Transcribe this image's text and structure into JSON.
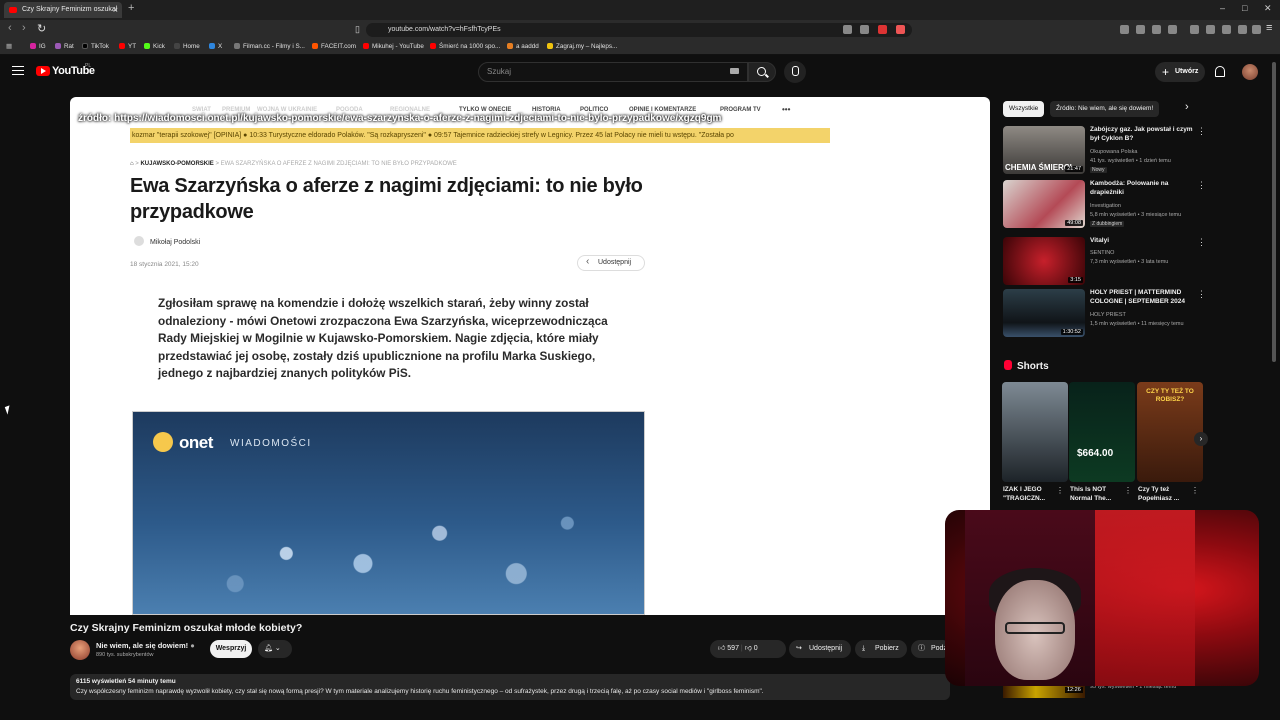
{
  "browser": {
    "tab_title": "Czy Skrajny Feminizm oszukał",
    "url": "youtube.com/watch?v=hFsfhTcyPEs",
    "bookmarks": [
      "IG",
      "Rat",
      "TikTok",
      "YT",
      "Kick",
      "Home",
      "X",
      "Filman.cc - Filmy i S...",
      "FACEIT.com",
      "Mikuhej - YouTube",
      "Śmierć na 1000 spo...",
      "a aaddd",
      "Zagraj.my – Najleps..."
    ]
  },
  "header": {
    "logo_text": "YouTube",
    "logo_country": "PL",
    "search_placeholder": "Szukaj",
    "create_label": "Utwórz"
  },
  "player": {
    "source_overlay": "źródło: https://wiadomosci.onet.pl/kujawsko-pomorskie/ewa-szarzynska-o-aferze-z-nagimi-zdjeciami-to-nie-bylo-przypadkowe/xgzq9gm",
    "nav_items": [
      "TYLKO W ONECIE",
      "HISTORIA",
      "POLITICO",
      "OPINIE I KOMENTARZE",
      "PROGRAM TV",
      "•••"
    ],
    "nav_items_faded": [
      "SWIAT",
      "PREMIUM",
      "WOJNA W UKRAINIE",
      "POGODA",
      "REGIONALNE"
    ],
    "ticker": "kozmar \"terapii szokowej\" [OPINIA]  ●  10:33  Turystyczne eldorado Polaków. \"Są rozkapryszeni\"  ●  09:57  Tajemnice radzieckiej strefy w Legnicy. Przez 45 lat Polacy nie mieli tu wstępu. \"Została po",
    "breadcrumb_region": "KUJAWSKO-POMORSKIE",
    "breadcrumb_current": "EWA SZARZYŃSKA O AFERZE Z NAGIMI ZDJĘCIAMI: TO NIE BYŁO PRZYPADKOWE",
    "article_title": "Ewa Szarzyńska o aferze z nagimi zdjęciami: to nie było przypadkowe",
    "author": "Mikołaj Podolski",
    "date": "18 stycznia 2021, 15:20",
    "share_label": "Udostępnij",
    "lead": "Zgłosiłam sprawę na komendzie i dołożę wszelkich starań, żeby winny został odnaleziony - mówi Onetowi zrozpaczona Ewa Szarzyńska, wiceprzewodnicząca Rady Miejskiej w Mogilnie w Kujawsko-Pomorskiem. Nagie zdjęcia, które miały przedstawiać jej osobę, zostały dziś upublicznione na profilu Marka Suskiego, jednego z najbardziej znanych polityków PiS.",
    "hero_logo": "onet",
    "hero_sub": "WIADOMOŚCI"
  },
  "video": {
    "title": "Czy Skrajny Feminizm oszukał młode kobiety?",
    "channel": "Nie wiem, ale się dowiem!",
    "subscribers": "890 tys. subskrybentów",
    "support_label": "Wesprzyj",
    "likes": "597",
    "dislikes": "0",
    "share_label": "Udostępnij",
    "download_label": "Pobierz",
    "more_label": "Podz",
    "stats": "6115 wyświetleń  54 minuty temu",
    "description": "Czy współczesny feminizm naprawdę wyzwolił kobiety, czy stał się nową formą presji? W tym materiale analizujemy historię ruchu feministycznego – od sufrażystek, przez drugą i trzecią falę, aż po czasy social mediów i \"girlboss feminism\"."
  },
  "sidebar": {
    "chips": [
      "Wszystkie",
      "Źródło: Nie wiem, ale się dowiem!"
    ],
    "recs": [
      {
        "title": "Zabójczy gaz. Jak powstał i czym był Cyklon B?",
        "channel": "Okupowana Polska",
        "meta": "41 tys. wyświetleń • 1 dzień temu",
        "badge": "Nowy",
        "duration": "21:47",
        "thumb_text": "CHEMIA ŚMIERCI"
      },
      {
        "title": "Kambodża: Polowanie na drapieżniki",
        "channel": "Investigation",
        "meta": "5,8 mln wyświetleń • 3 miesiące temu",
        "badge": "Z dubbingiem",
        "duration": "49:08"
      },
      {
        "title": "Vitalyi",
        "channel": "SENTINO",
        "meta": "7,3 mln wyświetleń • 3 lata temu",
        "duration": "3:15"
      },
      {
        "title": "HOLY PRIEST | MATTERMIND COLOGNE | SEPTEMBER 2024",
        "channel": "HOLY PRIEST",
        "meta": "1,5 mln wyświetleń • 11 miesięcy temu",
        "duration": "1:30:52"
      }
    ],
    "shorts_heading": "Shorts",
    "shorts": [
      {
        "title": "IZAK I JEGO \"TRAGICZN..."
      },
      {
        "title": "This Is NOT Normal The...",
        "overlay": "$664.00"
      },
      {
        "title": "Czy Ty też Popełniasz ...",
        "overlay": "CZY TY TEŻ TO ROBISZ?"
      }
    ],
    "bottom_rec": {
      "duration": "12:26",
      "meta": "95 tys. wyświetleń • 1 miesiąc temu"
    }
  }
}
